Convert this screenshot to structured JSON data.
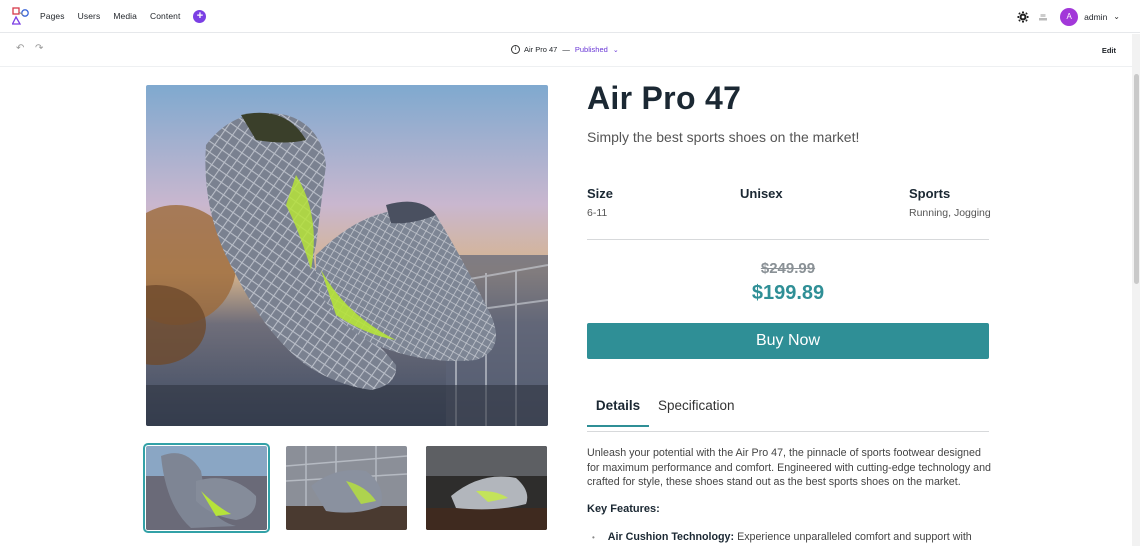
{
  "nav": {
    "items": [
      "Pages",
      "Users",
      "Media",
      "Content"
    ],
    "user": {
      "initial": "A",
      "name": "admin"
    }
  },
  "toolbar": {
    "page_title": "Air Pro 47",
    "dash": "—",
    "status": "Published",
    "edit_label": "Edit"
  },
  "product": {
    "title": "Air Pro 47",
    "subtitle": "Simply the best sports shoes on the market!",
    "specs": [
      {
        "label": "Size",
        "value": "6-11"
      },
      {
        "label": "Unisex",
        "value": ""
      },
      {
        "label": "Sports",
        "value": "Running, Jogging"
      }
    ],
    "old_price": "$249.99",
    "price": "$199.89",
    "buy_label": "Buy Now",
    "tabs": [
      "Details",
      "Specification"
    ],
    "description": "Unleash your potential with the Air Pro 47, the pinnacle of sports footwear designed for maximum performance and comfort. Engineered with cutting-edge technology and crafted for style, these shoes stand out as the best sports shoes on the market.",
    "key_features_label": "Key Features:",
    "features": [
      {
        "name": "Air Cushion Technology:",
        "text": "Experience unparalleled comfort and support with"
      }
    ]
  },
  "colors": {
    "accent": "#2f8f96",
    "brand": "#7b3fe4",
    "status": "#6a38d6"
  }
}
